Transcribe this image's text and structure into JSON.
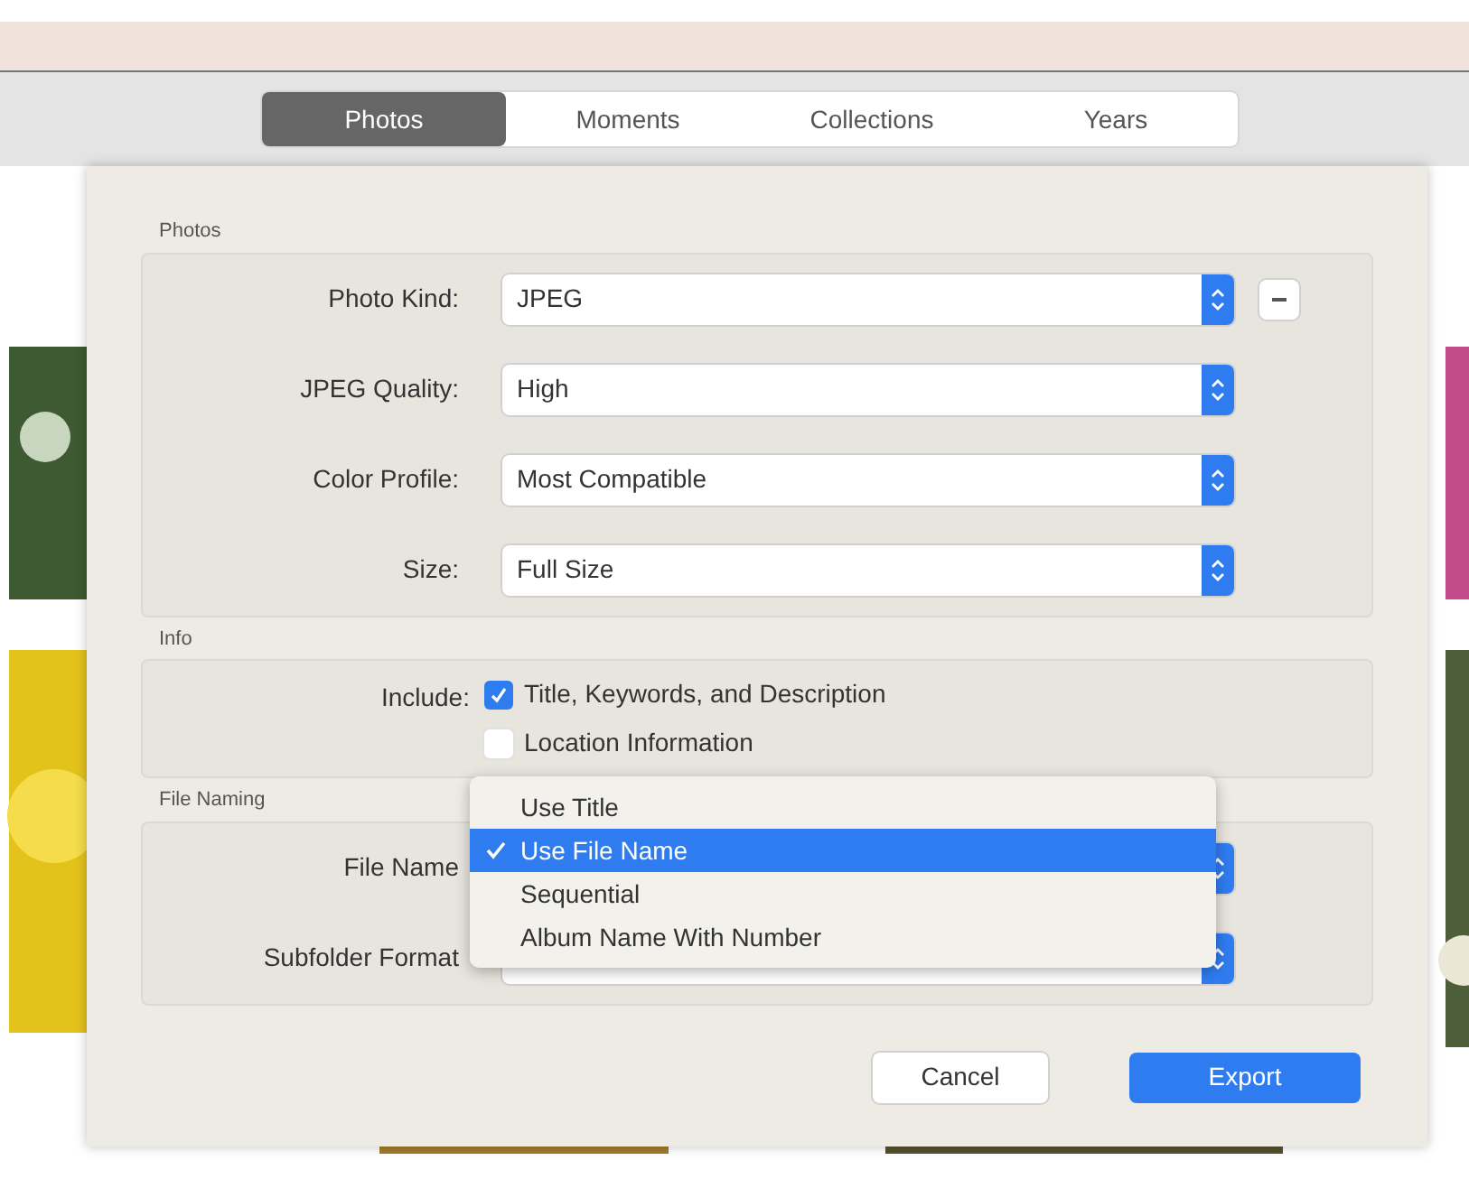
{
  "tabs": [
    {
      "label": "Photos",
      "selected": true
    },
    {
      "label": "Moments",
      "selected": false
    },
    {
      "label": "Collections",
      "selected": false
    },
    {
      "label": "Years",
      "selected": false
    }
  ],
  "sections": [
    {
      "title": "Photos",
      "kind": "popups",
      "rows": [
        {
          "label": "Photo Kind:",
          "value": "JPEG",
          "kind": "popup-with-remove"
        },
        {
          "label": "JPEG Quality:",
          "value": "High",
          "kind": "popup"
        },
        {
          "label": "Color Profile:",
          "value": "Most Compatible",
          "kind": "popup"
        },
        {
          "label": "Size:",
          "value": "Full Size",
          "kind": "popup"
        }
      ]
    },
    {
      "title": "Info",
      "kind": "checks",
      "label": "Include:",
      "checks": [
        {
          "label": "Title, Keywords, and Description",
          "checked": true
        },
        {
          "label": "Location Information",
          "checked": false
        }
      ]
    },
    {
      "title": "File Naming",
      "kind": "popups",
      "rows": [
        {
          "label": "File Name",
          "kind": "popup"
        },
        {
          "label": "Subfolder Format",
          "kind": "popup"
        }
      ]
    }
  ],
  "menu": {
    "items": [
      {
        "label": "Use Title",
        "selected": false
      },
      {
        "label": "Use File Name",
        "selected": true
      },
      {
        "label": "Sequential",
        "selected": false
      },
      {
        "label": "Album Name With Number",
        "selected": false
      }
    ]
  },
  "buttons": [
    {
      "label": "Cancel",
      "kind": "secondary"
    },
    {
      "label": "Export",
      "kind": "primary"
    }
  ]
}
